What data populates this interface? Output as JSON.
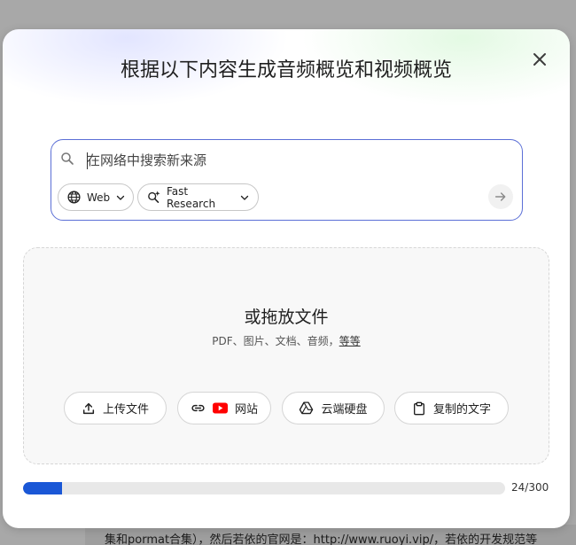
{
  "dialog": {
    "title": "根据以下内容生成音频概览和视频概览"
  },
  "search": {
    "placeholder": "在网络中搜索新来源",
    "value": "",
    "chips": {
      "source_label": "Web",
      "mode_label": "Fast Research"
    }
  },
  "drop_zone": {
    "title": "或拖放文件",
    "subtitle": "PDF、图片、文档、音频，",
    "more_link": "等等",
    "buttons": {
      "upload": "上传文件",
      "website": "网站",
      "drive": "云端硬盘",
      "paste": "复制的文字"
    }
  },
  "progress": {
    "current": 24,
    "max": 300,
    "label": "24/300"
  },
  "background": {
    "bottom_text": "集和pormat合集），然后若依的官网是：http://www.ruoyi.vip/，若依的开发规范等"
  },
  "colors": {
    "accent": "#1a57d6",
    "search_border": "#5b6fd6",
    "overlay": "#a9a9a9",
    "youtube_red": "#ff0000"
  },
  "icons": {
    "close": "close-icon",
    "search": "search-icon",
    "globe": "globe-icon",
    "research": "sparkle-search-icon",
    "chevron": "chevron-down-icon",
    "send": "arrow-right-icon",
    "upload": "upload-icon",
    "link": "link-icon",
    "youtube": "youtube-icon",
    "drive": "drive-icon",
    "clipboard": "clipboard-icon"
  }
}
